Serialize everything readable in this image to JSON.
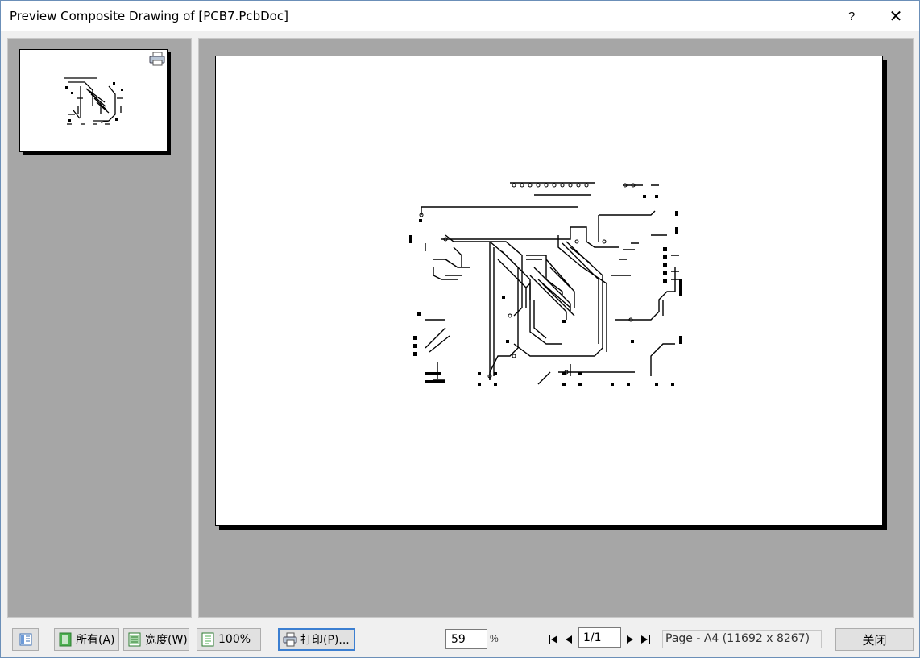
{
  "window": {
    "title": "Preview Composite Drawing of [PCB7.PcbDoc]",
    "help_label": "?",
    "close_label": "✕"
  },
  "toolbar": {
    "all_label": "所有(A)",
    "width_label": "宽度(W)",
    "actual_size_label": "100%",
    "print_label": "打印(P)...",
    "zoom_value": "59",
    "zoom_unit": "%",
    "page_value": "1/1",
    "page_info": "Page - A4 (11692 x 8267)",
    "close_button_label": "关闭"
  },
  "icons": {
    "pane_toggle": "pane-list-icon",
    "all": "page-green-icon",
    "width": "page-width-icon",
    "actual_size": "page-icon",
    "print": "printer-icon",
    "first": "first-page-icon",
    "prev": "prev-page-icon",
    "next": "next-page-icon",
    "last": "last-page-icon"
  }
}
